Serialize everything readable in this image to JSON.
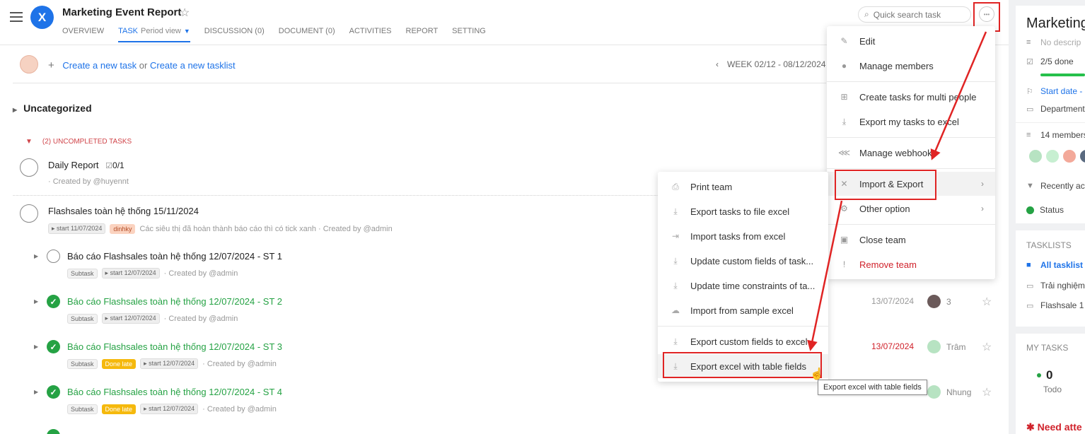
{
  "header": {
    "logo_glyph": "X",
    "title": "Marketing Event Report",
    "tabs": [
      {
        "label": "OVERVIEW"
      },
      {
        "label": "TASK",
        "sub": "Period view"
      },
      {
        "label": "DISCUSSION (0)"
      },
      {
        "label": "DOCUMENT (0)"
      },
      {
        "label": "ACTIVITIES"
      },
      {
        "label": "REPORT"
      },
      {
        "label": "SETTING"
      }
    ],
    "search_placeholder": "Quick search task",
    "more_glyph": "•••"
  },
  "create": {
    "create_task": "Create a new task",
    "or": "or",
    "create_tasklist": "Create a new tasklist"
  },
  "week": "WEEK 02/12 - 08/12/2024",
  "group": {
    "name": "Uncategorized",
    "uncompleted": "(2) UNCOMPLETED TASKS"
  },
  "tasks": {
    "daily": {
      "name": "Daily Report",
      "checklist": "0/1",
      "created": "· Created by @huyennt"
    },
    "flash": {
      "name": "Flashsales toàn hệ thống 15/11/2024",
      "start": "start 11/07/2024",
      "tag": "dinhky",
      "desc": "Các siêu thị đã hoàn thành báo cáo thì có tick xanh · Created by @admin"
    },
    "st1": {
      "name": "Báo cáo Flashsales toàn hệ thống 12/07/2024 - ST 1",
      "chip": "Subtask",
      "start": "start 12/07/2024",
      "created": "· Created by @admin"
    },
    "st2": {
      "name": "Báo cáo Flashsales toàn hệ thống 12/07/2024 - ST 2",
      "chip": "Subtask",
      "start": "start 12/07/2024",
      "created": "· Created by @admin",
      "due": "13/07/2024",
      "assignee": "3"
    },
    "st3": {
      "name": "Báo cáo Flashsales toàn hệ thống 12/07/2024 - ST 3",
      "chip": "Subtask",
      "late": "Done late",
      "start": "start 12/07/2024",
      "created": "· Created by @admin",
      "due": "13/07/2024",
      "assignee": "Trâm"
    },
    "st4": {
      "name": "Báo cáo Flashsales toàn hệ thống 12/07/2024 - ST 4",
      "chip": "Subtask",
      "late": "Done late",
      "start": "start 12/07/2024",
      "created": "· Created by @admin",
      "assignee": "Nhung"
    }
  },
  "menu": {
    "edit": "Edit",
    "manage_members": "Manage members",
    "create_multi": "Create tasks for multi people",
    "export_my": "Export my tasks to excel",
    "webhooks": "Manage webhooks",
    "import_export": "Import & Export",
    "other": "Other option",
    "close_team": "Close team",
    "remove_team": "Remove team"
  },
  "submenu": {
    "print": "Print team",
    "export_file": "Export tasks to file excel",
    "import_excel": "Import tasks from excel",
    "update_custom": "Update custom fields of task...",
    "update_time": "Update time constraints of ta...",
    "import_sample": "Import from sample excel",
    "export_custom": "Export custom fields to excel",
    "export_table": "Export excel with table fields"
  },
  "tooltip": "Export excel with table fields",
  "right_panel": {
    "title": "Marketing",
    "no_desc": "No descrip",
    "done": "2/5 done",
    "start_date": "Start date -",
    "department": "Department",
    "members": "14 members",
    "recently": "Recently act",
    "status": "Status",
    "tasklists_head": "TASKLISTS",
    "all_tasklists": "All tasklist",
    "tl1": "Trải nghiệm",
    "tl2": "Flashsale 1",
    "my_tasks_head": "MY TASKS",
    "todo_num": "0",
    "todo_label": "Todo",
    "need": "Need atte"
  },
  "colors": {
    "accent": "#1e73e8",
    "highlight": "#e02424",
    "done": "#25a244",
    "late": "#d0222b"
  }
}
